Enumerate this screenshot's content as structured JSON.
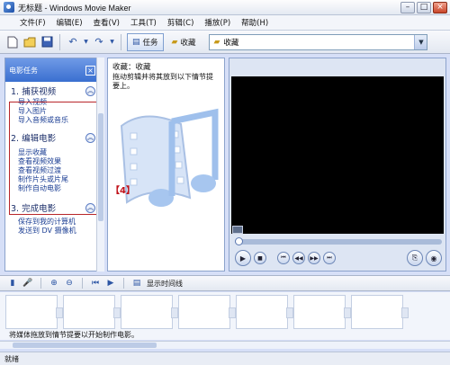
{
  "window": {
    "title": "无标题 - Windows Movie Maker"
  },
  "menu": [
    "文件(F)",
    "编辑(E)",
    "查看(V)",
    "工具(T)",
    "剪辑(C)",
    "播放(P)",
    "帮助(H)"
  ],
  "toolbar": {
    "tasks_label": "任务",
    "collections_label": "收藏",
    "collection_value": "收藏"
  },
  "task_pane": {
    "header": "电影任务",
    "sections": [
      {
        "number": "1.",
        "title": "捕获视频",
        "links": [
          "导入视频",
          "导入图片",
          "导入音频或音乐"
        ]
      },
      {
        "number": "2.",
        "title": "编辑电影",
        "links": [
          "显示收藏",
          "查看视频效果",
          "查看视频过渡",
          "制作片头或片尾",
          "制作自动电影"
        ]
      },
      {
        "number": "3.",
        "title": "完成电影",
        "links": [
          "保存到我的计算机",
          "发送到 DV 摄像机"
        ]
      }
    ]
  },
  "collection": {
    "title": "收藏：收藏",
    "description": "拖动剪辑并将其放到以下情节提要上。",
    "callout": "【4】"
  },
  "storyboard": {
    "show_timeline_label": "显示时间线",
    "hint": "将媒体拖放到情节提要以开始制作电影。"
  },
  "status": {
    "text": "就绪"
  }
}
